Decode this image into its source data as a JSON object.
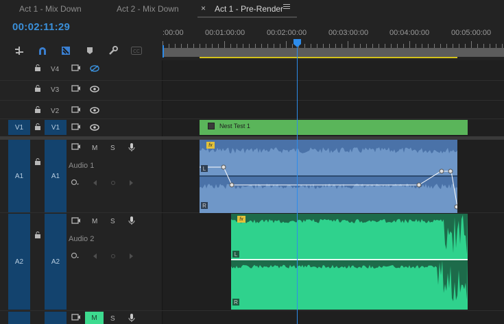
{
  "tabs": [
    {
      "label": "Act 1 - Mix Down",
      "active": false
    },
    {
      "label": "Act 2 - Mix Down",
      "active": false
    },
    {
      "label": "Act 1 - Pre-Render",
      "active": true
    }
  ],
  "tab_close": "×",
  "timecode": "00:02:11:29",
  "ruler": {
    "labels": [
      ":00:00",
      "00:01:00:00",
      "00:02:00:00",
      "00:03:00:00",
      "00:04:00:00",
      "00:05:00:00"
    ]
  },
  "tools": [
    "snap-icon",
    "linked-selection-icon",
    "insert-icon",
    "marker-icon",
    "wrench-icon",
    "captions-icon"
  ],
  "tools_glyphs": [
    "⇹",
    "∩",
    "▚",
    "⬟",
    "🔧",
    "CC"
  ],
  "video_tracks": [
    {
      "target": "V4",
      "source": "",
      "selected": false
    },
    {
      "target": "V3",
      "source": "",
      "selected": false
    },
    {
      "target": "V2",
      "source": "",
      "selected": false
    },
    {
      "target": "V1",
      "source": "V1",
      "selected": true
    }
  ],
  "audio_tracks": [
    {
      "source": "A1",
      "target": "A1",
      "name": "Audio 1",
      "mute": "M",
      "solo": "S"
    },
    {
      "source": "A2",
      "target": "A2",
      "name": "Audio 2",
      "mute": "M",
      "solo": "S"
    },
    {
      "source": "",
      "target": "",
      "name": "",
      "mute": "M",
      "solo": "S"
    }
  ],
  "clips": {
    "video_clip_name": "Nest Test 1",
    "fx_label": "fx",
    "left_channel": "L",
    "right_channel": "R"
  },
  "colors": {
    "accent": "#2d8ceb",
    "video_clip": "#5ab55a",
    "audio1_clip": "#6f97c8",
    "audio2_clip": "#2fd28d",
    "work_area_yellow": "#d4c21a"
  }
}
